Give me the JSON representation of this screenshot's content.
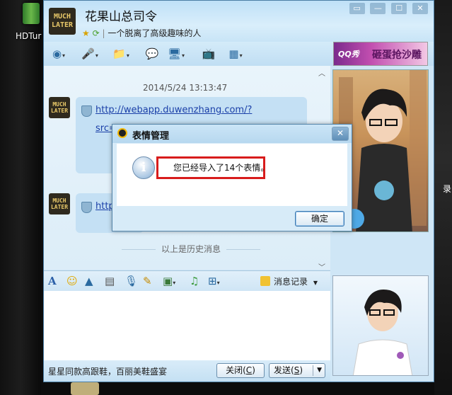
{
  "desktop": {
    "left_icon_label": "HDTur",
    "right_icon_label": "录"
  },
  "window": {
    "contact_name": "花果山总司令",
    "contact_signature": "一个脱离了高级趣味的人",
    "avatar_text": "MUCH LATER",
    "ad_banner": {
      "logo": "QQ秀",
      "text": "砸蛋抢沙雕"
    }
  },
  "chat": {
    "timestamp": "2014/5/24 13:13:47",
    "messages": [
      {
        "text": "http://webapp.duwenzhang.com/?src=http://www.duwenzhang.com/wenzhang/shenghuosuibi/20080116/m/wenzhang"
      },
      {
        "text": "http://huosuibi"
      }
    ],
    "history_divider": "以上是历史消息"
  },
  "input_toolbar": {
    "history_label": "消息记录"
  },
  "bottom": {
    "promo_text": "星星同款高跟鞋，百丽美鞋盛宴",
    "close_label": "关闭(",
    "close_key": "C",
    "close_suffix": ")",
    "send_label": "发送(",
    "send_key": "S",
    "send_suffix": ")"
  },
  "dialog": {
    "title": "表情管理",
    "message": "您已经导入了14个表情。",
    "ok_label": "确定",
    "close_glyph": "✕"
  },
  "colors": {
    "highlight_border": "#d81c1c",
    "link": "#1a3fa8",
    "window_bg": "#cfe6f6"
  }
}
